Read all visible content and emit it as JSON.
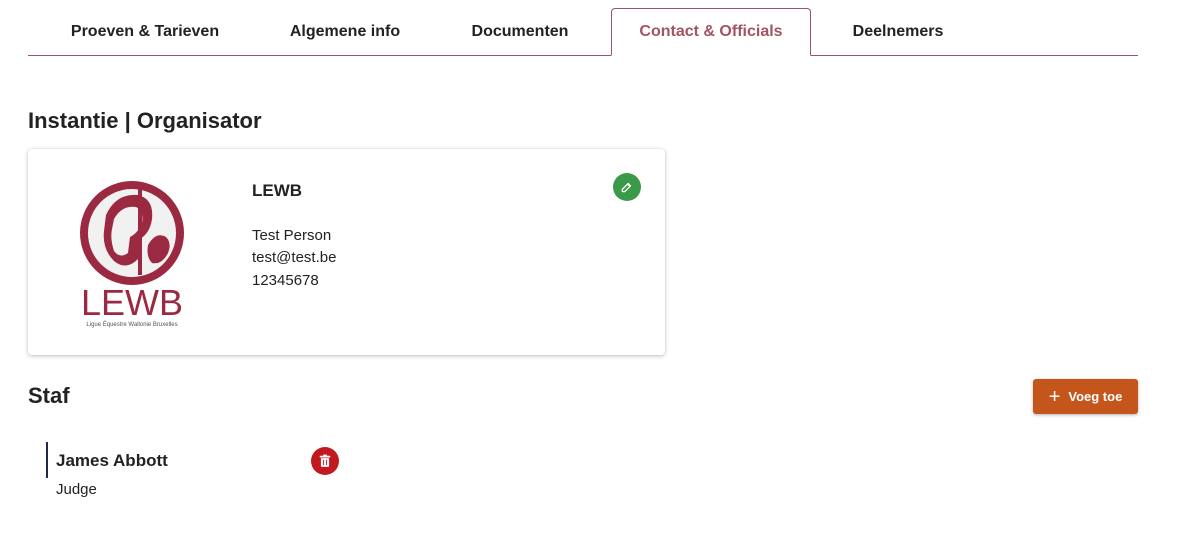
{
  "tabs": [
    {
      "label": "Proeven & Tarieven"
    },
    {
      "label": "Algemene info"
    },
    {
      "label": "Documenten"
    },
    {
      "label": "Contact & Officials"
    },
    {
      "label": "Deelnemers"
    }
  ],
  "active_tab": "Contact & Officials",
  "organizer": {
    "section_title": "Instantie | Organisator",
    "name": "LEWB",
    "contact_person": "Test Person",
    "email": "test@test.be",
    "phone": "12345678",
    "logo": {
      "text": "LEWB",
      "subtext": "Ligue Équestre Wallonie Bruxelles",
      "color": "#9b2942"
    },
    "edit_icon": "edit-icon"
  },
  "staff": {
    "section_title": "Staf",
    "add_label": "Voeg toe",
    "members": [
      {
        "name": "James Abbott",
        "role": "Judge"
      }
    ],
    "delete_icon": "trash-icon"
  },
  "colors": {
    "accent": "#a35462",
    "edit_green": "#3a9a4a",
    "add_orange": "#c4561c",
    "delete_red": "#c2181f"
  }
}
